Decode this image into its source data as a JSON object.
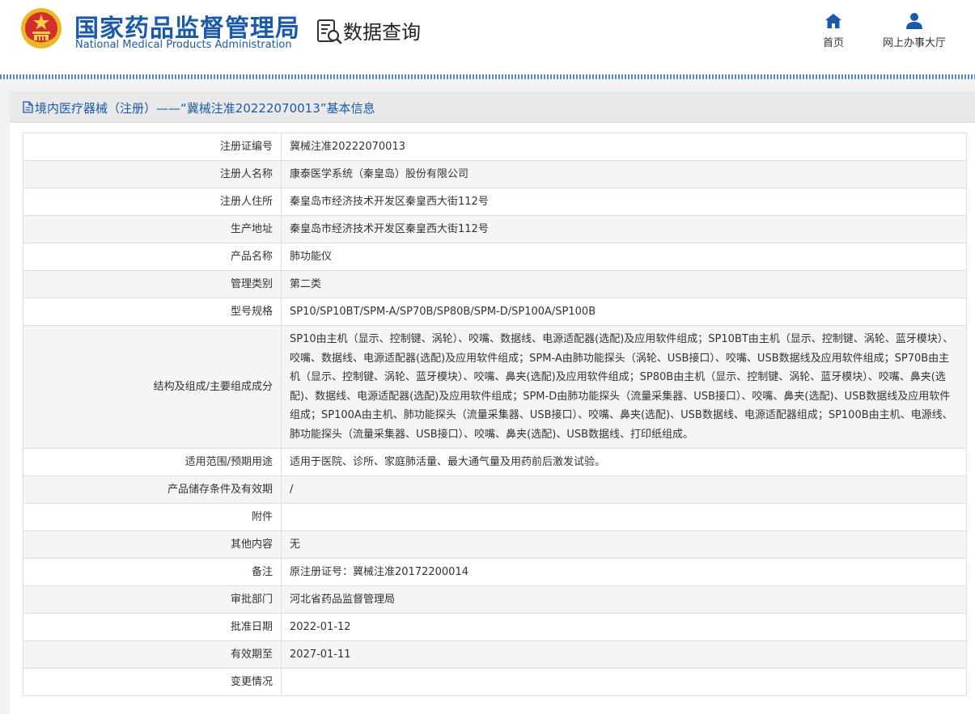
{
  "header": {
    "brand_cn": "国家药品监督管理局",
    "brand_en": "National Medical Products Administration",
    "query_title": "数据查询",
    "nav": [
      {
        "label": "首页",
        "icon": "home-icon"
      },
      {
        "label": "网上办事大厅",
        "icon": "user-icon"
      }
    ]
  },
  "colors": {
    "brand": "#1a5aa8",
    "panel_head": "#e9e9e9",
    "row_alt": "#f5f5f5"
  },
  "panel": {
    "title": "境内医疗器械（注册）——“冀械注准20222070013”基本信息",
    "rows": [
      {
        "key": "注册证编号",
        "value": "冀械注准20222070013"
      },
      {
        "key": "注册人名称",
        "value": "康泰医学系统（秦皇岛）股份有限公司"
      },
      {
        "key": "注册人住所",
        "value": "秦皇岛市经济技术开发区秦皇西大街112号"
      },
      {
        "key": "生产地址",
        "value": "秦皇岛市经济技术开发区秦皇西大街112号"
      },
      {
        "key": "产品名称",
        "value": "肺功能仪"
      },
      {
        "key": "管理类别",
        "value": "第二类"
      },
      {
        "key": "型号规格",
        "value": "SP10/SP10BT/SPM-A/SP70B/SP80B/SPM-D/SP100A/SP100B"
      },
      {
        "key": "结构及组成/主要组成成分",
        "value": "SP10由主机（显示、控制键、涡轮）、咬嘴、数据线、电源适配器(选配)及应用软件组成；SP10BT由主机（显示、控制键、涡轮、蓝牙模块）、咬嘴、数据线、电源适配器(选配)及应用软件组成；SPM-A由肺功能探头（涡轮、USB接口）、咬嘴、USB数据线及应用软件组成；SP70B由主机（显示、控制键、涡轮、蓝牙模块）、咬嘴、鼻夹(选配)及应用软件组成；SP80B由主机（显示、控制键、涡轮、蓝牙模块）、咬嘴、鼻夹(选配)、数据线、电源适配器(选配)及应用软件组成；SPM-D由肺功能探头（流量采集器、USB接口）、咬嘴、鼻夹(选配)、USB数据线及应用软件组成；SP100A由主机、肺功能探头（流量采集器、USB接口）、咬嘴、鼻夹(选配)、USB数据线、电源适配器组成；SP100B由主机、电源线、肺功能探头（流量采集器、USB接口）、咬嘴、鼻夹(选配)、USB数据线、打印纸组成。"
      },
      {
        "key": "适用范围/预期用途",
        "value": "适用于医院、诊所、家庭肺活量、最大通气量及用药前后激发试验。"
      },
      {
        "key": "产品储存条件及有效期",
        "value": "/"
      },
      {
        "key": "附件",
        "value": ""
      },
      {
        "key": "其他内容",
        "value": "无"
      },
      {
        "key": "备注",
        "value": "原注册证号：冀械注准20172200014"
      },
      {
        "key": "审批部门",
        "value": "河北省药品监督管理局"
      },
      {
        "key": "批准日期",
        "value": "2022-01-12"
      },
      {
        "key": "有效期至",
        "value": "2027-01-11"
      },
      {
        "key": "变更情况",
        "value": ""
      }
    ]
  }
}
